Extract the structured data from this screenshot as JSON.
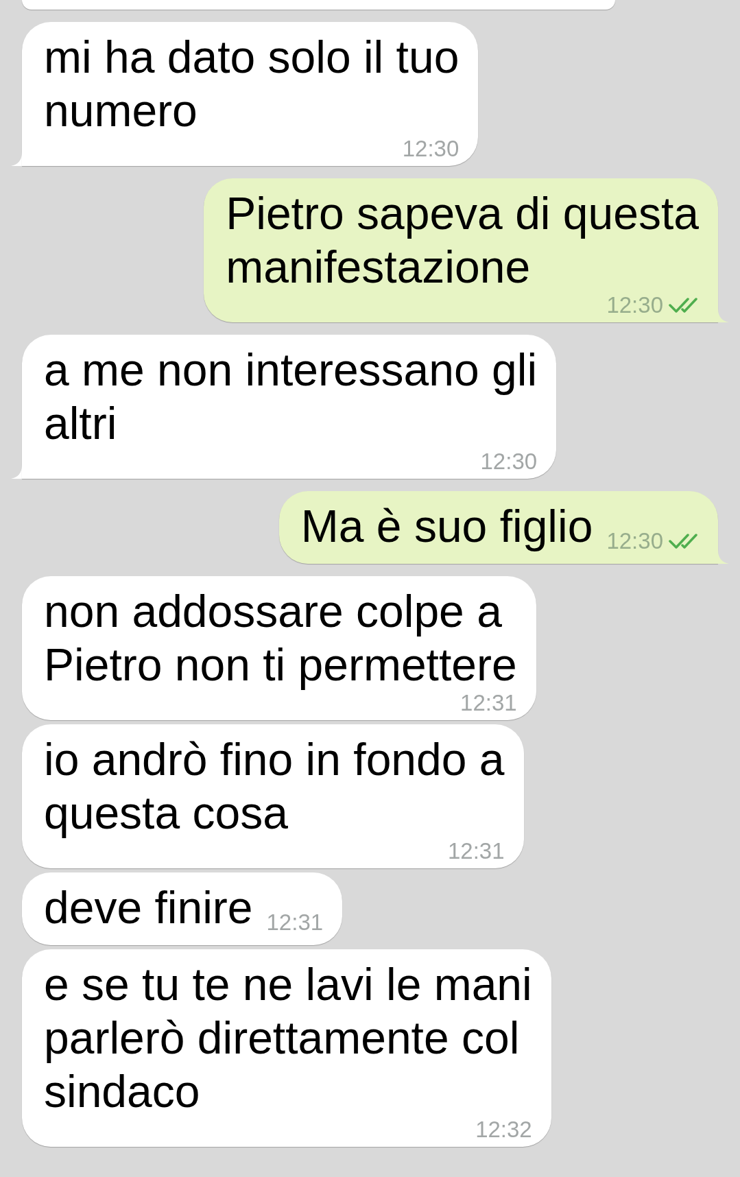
{
  "messages": [
    {
      "kind": "incoming",
      "tail": true,
      "text": "mi ha dato solo il tuo\nnumero",
      "time": "12:30"
    },
    {
      "kind": "outgoing",
      "tail": true,
      "text": "Pietro sapeva di questa\nmanifestazione",
      "time": "12:30",
      "read": true
    },
    {
      "kind": "incoming",
      "tail": true,
      "text": "a me non interessano gli\naltri",
      "time": "12:30"
    },
    {
      "kind": "outgoing",
      "tail": true,
      "text": "Ma è suo figlio",
      "time": "12:30",
      "read": true
    },
    {
      "kind": "incoming",
      "tail": false,
      "text": "non addossare colpe a\nPietro non ti permettere",
      "time": "12:31"
    },
    {
      "kind": "incoming",
      "tail": false,
      "text": "io andrò fino in fondo a\nquesta cosa",
      "time": "12:31"
    },
    {
      "kind": "incoming",
      "tail": false,
      "text": "deve finire",
      "time": "12:31"
    },
    {
      "kind": "incoming",
      "tail": false,
      "text": "e se tu te ne lavi le mani\nparlerò direttamente col\nsindaco",
      "time": "12:32"
    }
  ]
}
